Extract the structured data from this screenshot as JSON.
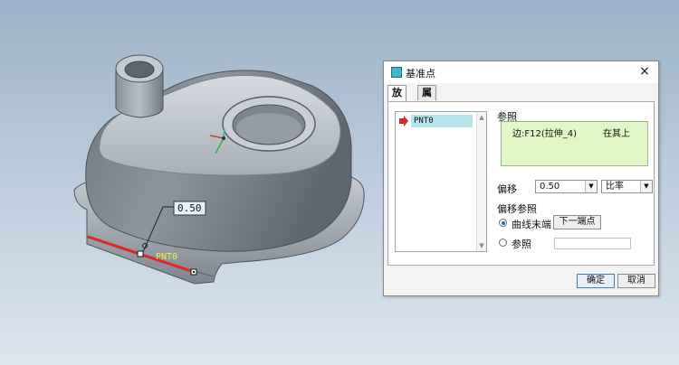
{
  "model": {
    "offset_tag": "0.50",
    "point_tag": "PNT0"
  },
  "dialog": {
    "title": "基准点",
    "close_symbol": "×",
    "tabs": [
      {
        "label": "放置",
        "active": true
      },
      {
        "label": "属性",
        "active": false
      }
    ],
    "point_list": [
      "PNT0"
    ],
    "reference_label": "参照",
    "reference_entry": "边:F12(拉伸_4)",
    "reference_constraint": "在其上",
    "offset_label": "偏移",
    "offset_value": "0.50",
    "offset_type": "比率",
    "offset_ref_label": "偏移参照",
    "curve_end_label": "曲线末端",
    "next_end_button": "下一端点",
    "reference_option_label": "参照",
    "ok_button": "确定",
    "cancel_button": "取消"
  },
  "colors": {
    "highlight_edge": "#e22424",
    "reference_bg": "#e2f7c7",
    "list_selection": "#b6e3ec",
    "point_label": "#f2ef35"
  }
}
